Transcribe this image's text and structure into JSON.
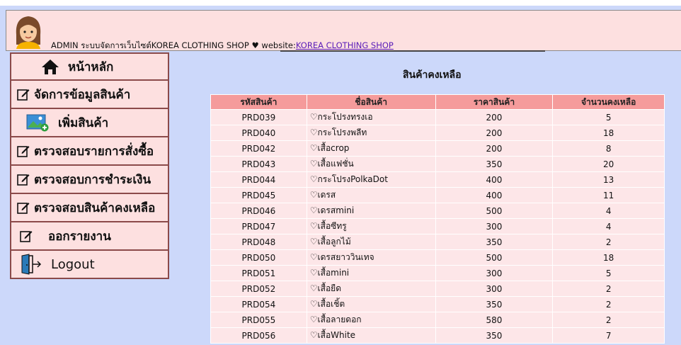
{
  "header": {
    "admin_text": "ADMIN ระบบจัดการเว็บไซต์KOREA CLOTHING SHOP",
    "heart": "♥",
    "website_prefix": "website:",
    "website_link": "KOREA CLOTHING SHOP"
  },
  "sidebar": {
    "items": [
      {
        "label": "หน้าหลัก",
        "icon": "home-icon"
      },
      {
        "label": "จัดการข้อมูลสินค้า",
        "icon": "edit-icon"
      },
      {
        "label": "เพิ่มสินค้า",
        "icon": "add-image-icon"
      },
      {
        "label": "ตรวจสอบรายการสั่งซื้อ",
        "icon": "edit-icon"
      },
      {
        "label": "ตรวจสอบการชำระเงิน",
        "icon": "edit-icon"
      },
      {
        "label": "ตรวจสอบสินค้าคงเหลือ",
        "icon": "edit-icon"
      },
      {
        "label": "ออกรายงาน",
        "icon": "edit-icon"
      },
      {
        "label": "Logout",
        "icon": "logout-icon"
      }
    ]
  },
  "main": {
    "title": "สินค้าคงเหลือ",
    "columns": [
      "รหัสสินค้า",
      "ชื่อสินค้า",
      "ราคาสินค้า",
      "จำนวนคงเหลือ"
    ],
    "rows": [
      {
        "id": "PRD039",
        "name": "♡กระโปรงทรงเอ",
        "price": "200",
        "qty": "5"
      },
      {
        "id": "PRD040",
        "name": "♡กระโปรงพลีท",
        "price": "200",
        "qty": "18"
      },
      {
        "id": "PRD042",
        "name": "♡เสื้อcrop",
        "price": "200",
        "qty": "8"
      },
      {
        "id": "PRD043",
        "name": "♡เสื้อแฟชั่น",
        "price": "350",
        "qty": "20"
      },
      {
        "id": "PRD044",
        "name": "♡กระโปรงPolkaDot",
        "price": "400",
        "qty": "13"
      },
      {
        "id": "PRD045",
        "name": "♡เดรส",
        "price": "400",
        "qty": "11"
      },
      {
        "id": "PRD046",
        "name": "♡เดรสmini",
        "price": "500",
        "qty": "4"
      },
      {
        "id": "PRD047",
        "name": "♡เสื้อซีทรู",
        "price": "300",
        "qty": "4"
      },
      {
        "id": "PRD048",
        "name": "♡เสื้อลูกไม้",
        "price": "350",
        "qty": "2"
      },
      {
        "id": "PRD050",
        "name": "♡เดรสยาววินเทจ",
        "price": "500",
        "qty": "18"
      },
      {
        "id": "PRD051",
        "name": "♡เสื้อmini",
        "price": "300",
        "qty": "5"
      },
      {
        "id": "PRD052",
        "name": "♡เสื้อยืด",
        "price": "300",
        "qty": "2"
      },
      {
        "id": "PRD054",
        "name": "♡เสื้อเชิ้ต",
        "price": "350",
        "qty": "2"
      },
      {
        "id": "PRD055",
        "name": "♡เสื้อลายดอก",
        "price": "580",
        "qty": "2"
      },
      {
        "id": "PRD056",
        "name": "♡เสื้อWhite",
        "price": "350",
        "qty": "7"
      }
    ]
  }
}
